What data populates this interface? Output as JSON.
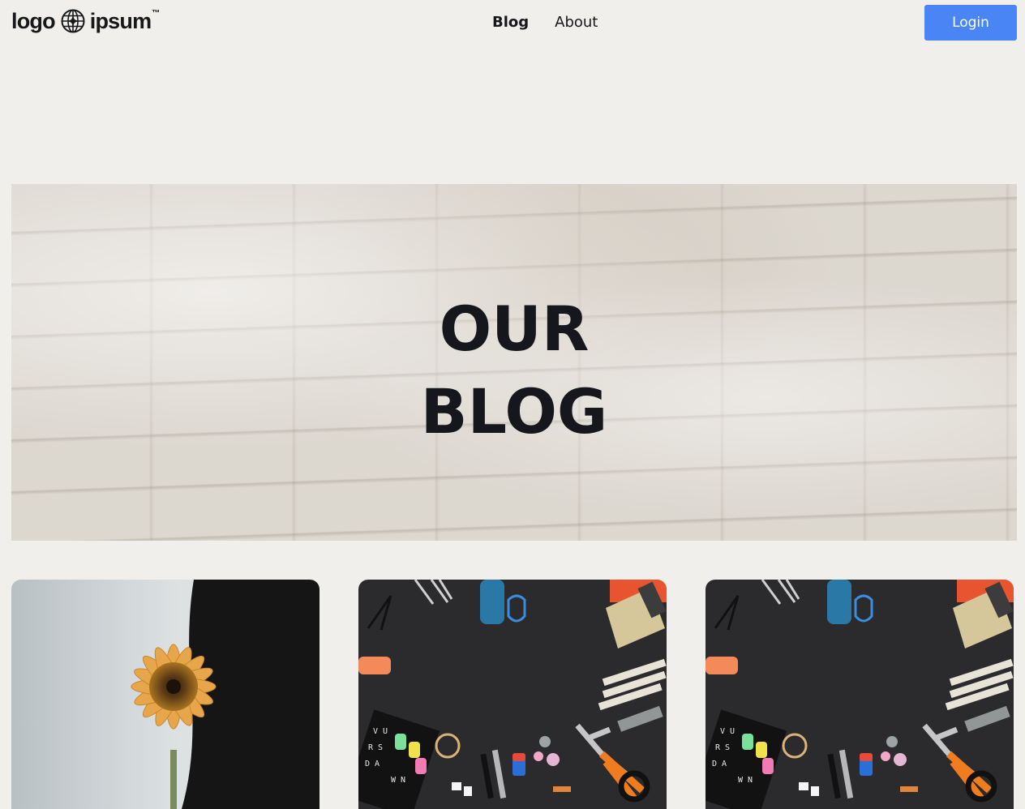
{
  "header": {
    "logo": {
      "text_left": "logo",
      "text_right": "ipsum",
      "icon": "globe-logo-icon"
    },
    "nav": [
      {
        "label": "Blog",
        "active": true
      },
      {
        "label": "About",
        "active": false
      }
    ],
    "login_label": "Login"
  },
  "hero": {
    "title_line1": "OUR",
    "title_line2": "BLOG",
    "background": "white brick wall texture"
  },
  "cards": [
    {
      "image": "sunflower-photo"
    },
    {
      "image": "craft-tools-photo"
    },
    {
      "image": "craft-tools-photo"
    }
  ],
  "colors": {
    "page_bg": "#f1efeb",
    "accent": "#4a85f6",
    "text": "#15171c"
  }
}
